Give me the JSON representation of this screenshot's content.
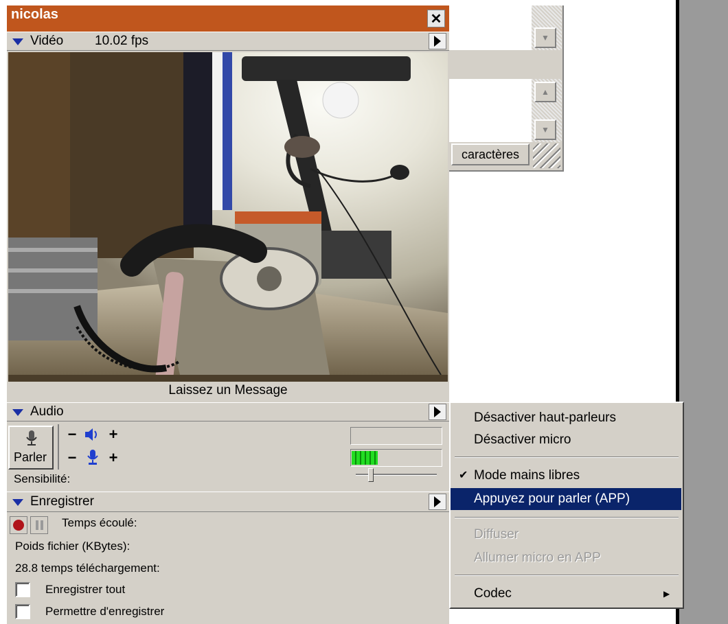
{
  "chat_window": {
    "characters_label": "caractères"
  },
  "main_window": {
    "title": "nicolas",
    "close_glyph": "✕",
    "video": {
      "section_label": "Vidéo",
      "fps": "10.02 fps",
      "message_label": "Laissez un Message"
    },
    "audio": {
      "section_label": "Audio",
      "talk_button_label": "Parler",
      "minus_glyph": "−",
      "plus_glyph": "+",
      "sensitivity_label": "Sensibilité:",
      "mic_level_fraction": 0.29
    },
    "record": {
      "section_label": "Enregistrer",
      "elapsed_label": "Temps écoulé:",
      "file_size_label": "Poids fichier (KBytes):",
      "download_time_label": "28.8 temps téléchargement:",
      "record_all_label": "Enregistrer tout",
      "allow_record_label": "Permettre d'enregistrer"
    }
  },
  "context_menu": {
    "items": [
      {
        "label": "Désactiver haut-parleurs",
        "state": "normal"
      },
      {
        "label": "Désactiver micro",
        "state": "normal"
      },
      {
        "label": "Mode mains libres",
        "state": "checked"
      },
      {
        "label": "Appuyez pour parler (APP)",
        "state": "highlighted"
      },
      {
        "label": "Diffuser",
        "state": "disabled"
      },
      {
        "label": "Allumer micro en APP",
        "state": "disabled"
      },
      {
        "label": "Codec",
        "state": "submenu"
      }
    ],
    "check_glyph": "✔",
    "submenu_glyph": "▶"
  },
  "colors": {
    "title_bar": "#c0561d",
    "menu_highlight": "#0a246a",
    "level_meter": "#22dd22"
  }
}
